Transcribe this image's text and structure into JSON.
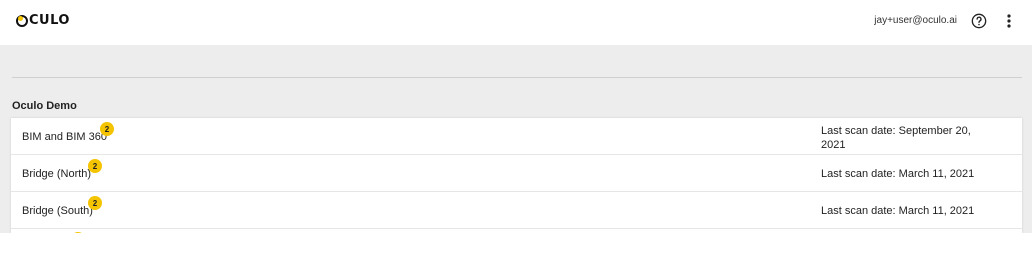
{
  "app": {
    "logo_text": "CULO",
    "brand_color": "#f5c400"
  },
  "header": {
    "user_email": "jay+user@oculo.ai",
    "help_icon": "help-circle-icon",
    "more_icon": "more-vertical-icon"
  },
  "section": {
    "title": "Oculo Demo"
  },
  "projects": [
    {
      "name": "BIM and BIM 360",
      "badge": "2",
      "date_line1": "Last scan date: September 20,",
      "date_line2": "2021"
    },
    {
      "name": "Bridge (North)",
      "badge": "2",
      "date_line1": "Last scan date: March 11, 2021",
      "date_line2": ""
    },
    {
      "name": "Bridge (South)",
      "badge": "2",
      "date_line1": "Last scan date: March 11, 2021",
      "date_line2": ""
    }
  ]
}
